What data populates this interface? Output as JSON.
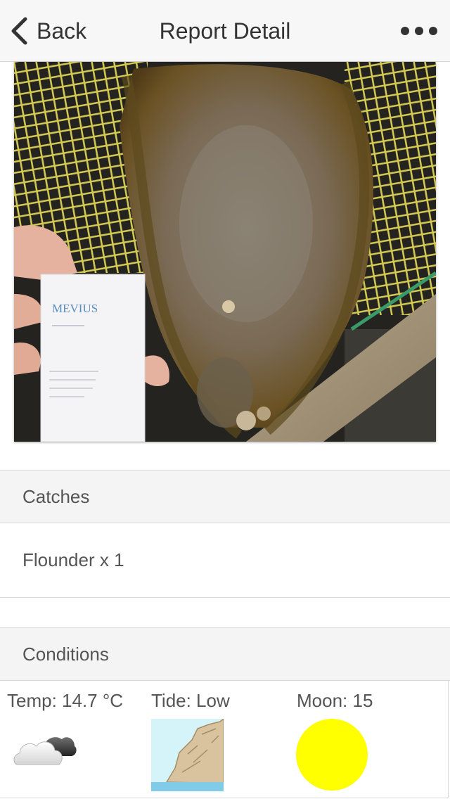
{
  "nav": {
    "back_label": "Back",
    "title": "Report Detail",
    "more_icon": "ellipsis-icon"
  },
  "photo": {
    "card_text": "MEVIUS"
  },
  "sections": {
    "catches_header": "Catches",
    "conditions_header": "Conditions"
  },
  "catches": [
    {
      "label": "Flounder x 1"
    }
  ],
  "conditions": {
    "temp": "Temp: 14.7 °C",
    "tide": "Tide: Low",
    "moon": "Moon: 15",
    "weather_icon": "cloudy-icon",
    "tide_icon": "low-tide-cliff-icon",
    "moon_icon": "full-moon-icon",
    "moon_color": "#ffff00"
  },
  "colors": {
    "navbar_bg": "#f7f7f7",
    "section_bg": "#f4f4f4",
    "text": "#333333"
  }
}
